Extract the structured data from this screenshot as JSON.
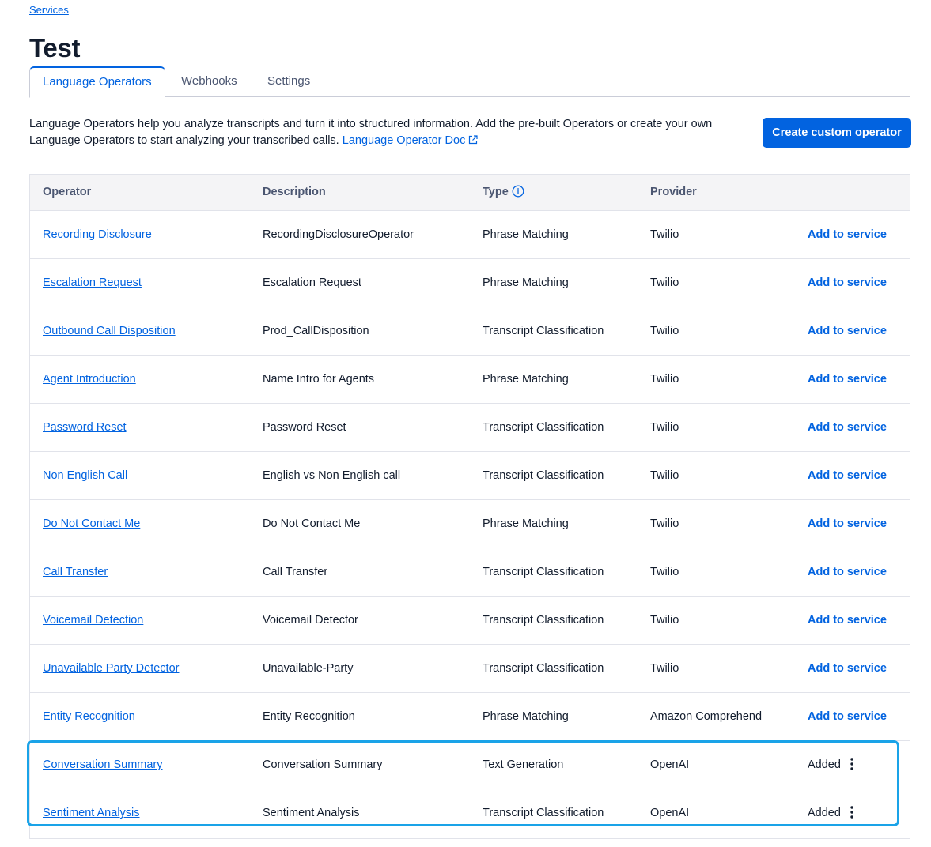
{
  "breadcrumb": {
    "label": "Services"
  },
  "page": {
    "title": "Test"
  },
  "tabs": [
    {
      "label": "Language Operators",
      "active": true
    },
    {
      "label": "Webhooks",
      "active": false
    },
    {
      "label": "Settings",
      "active": false
    }
  ],
  "intro": {
    "text": "Language Operators help you analyze transcripts and turn it into structured information. Add the pre-built Operators or create your own Language Operators to start analyzing your transcribed calls.",
    "link_label": "Language Operator Doc"
  },
  "create_button": {
    "label": "Create custom operator"
  },
  "table": {
    "headers": {
      "operator": "Operator",
      "description": "Description",
      "type": "Type",
      "provider": "Provider"
    },
    "rows": [
      {
        "operator": "Recording Disclosure",
        "description": "RecordingDisclosureOperator",
        "type": "Phrase Matching",
        "provider": "Twilio",
        "action": "Add to service"
      },
      {
        "operator": "Escalation Request",
        "description": "Escalation Request",
        "type": "Phrase Matching",
        "provider": "Twilio",
        "action": "Add to service"
      },
      {
        "operator": "Outbound Call Disposition",
        "description": "Prod_CallDisposition",
        "type": "Transcript Classification",
        "provider": "Twilio",
        "action": "Add to service"
      },
      {
        "operator": "Agent Introduction",
        "description": "Name Intro for Agents",
        "type": "Phrase Matching",
        "provider": "Twilio",
        "action": "Add to service"
      },
      {
        "operator": "Password Reset",
        "description": "Password Reset",
        "type": "Transcript Classification",
        "provider": "Twilio",
        "action": "Add to service"
      },
      {
        "operator": "Non English Call",
        "description": "English vs Non English call",
        "type": "Transcript Classification",
        "provider": "Twilio",
        "action": "Add to service"
      },
      {
        "operator": "Do Not Contact Me",
        "description": "Do Not Contact Me",
        "type": "Phrase Matching",
        "provider": "Twilio",
        "action": "Add to service"
      },
      {
        "operator": "Call Transfer",
        "description": "Call Transfer",
        "type": "Transcript Classification",
        "provider": "Twilio",
        "action": "Add to service"
      },
      {
        "operator": "Voicemail Detection",
        "description": "Voicemail Detector",
        "type": "Transcript Classification",
        "provider": "Twilio",
        "action": "Add to service"
      },
      {
        "operator": "Unavailable Party Detector",
        "description": "Unavailable-Party",
        "type": "Transcript Classification",
        "provider": "Twilio",
        "action": "Add to service"
      },
      {
        "operator": "Entity Recognition",
        "description": "Entity Recognition",
        "type": "Phrase Matching",
        "provider": "Amazon Comprehend",
        "action": "Add to service"
      },
      {
        "operator": "Conversation Summary",
        "description": "Conversation Summary",
        "type": "Text Generation",
        "provider": "OpenAI",
        "action": "Added"
      },
      {
        "operator": "Sentiment Analysis",
        "description": "Sentiment Analysis",
        "type": "Transcript Classification",
        "provider": "OpenAI",
        "action": "Added"
      }
    ]
  },
  "icons": {
    "external_link": "external-link-icon",
    "info": "info-icon",
    "more": "kebab-menu-icon"
  },
  "colors": {
    "primary": "#0263e0",
    "highlight": "#1aa3e8",
    "header_bg": "#f4f4f6"
  }
}
